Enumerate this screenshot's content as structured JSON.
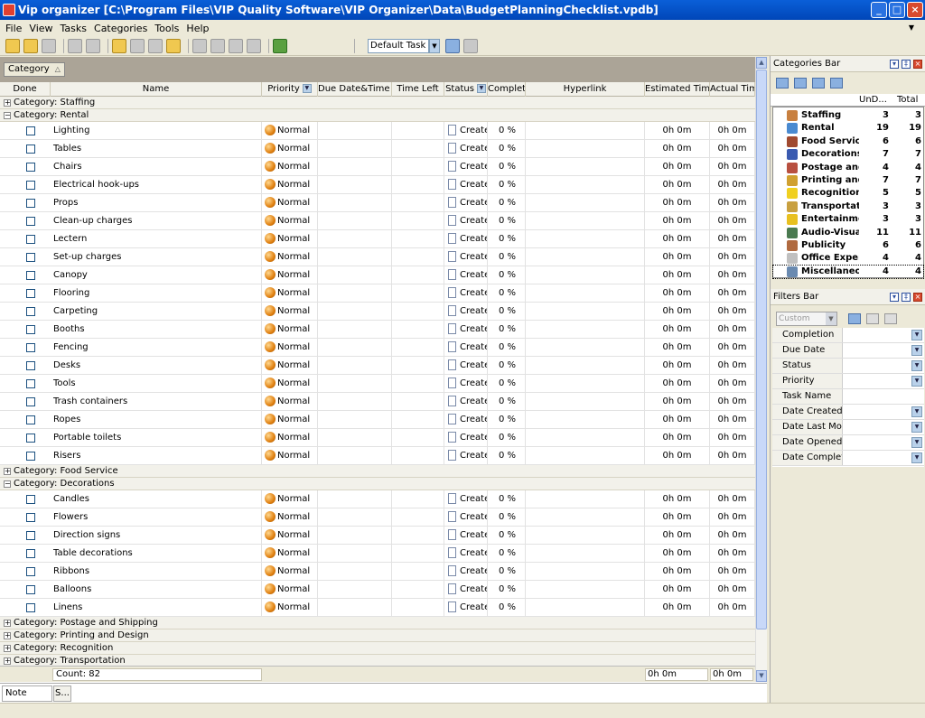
{
  "window": {
    "title": "Vip organizer [C:\\Program Files\\VIP Quality Software\\VIP Organizer\\Data\\BudgetPlanningChecklist.vpdb]"
  },
  "menu": [
    "File",
    "View",
    "Tasks",
    "Categories",
    "Tools",
    "Help"
  ],
  "toolbar": {
    "view_value": "Default Task V"
  },
  "group_chip": "Category",
  "columns": [
    "Done",
    "Name",
    "Priority",
    "Due Date&Time",
    "Time Left",
    "Status",
    "Complete",
    "Hyperlink",
    "Estimated Time",
    "Actual Time"
  ],
  "row_defaults": {
    "priority": "Normal",
    "status": "Create",
    "complete": "0 %",
    "estimated": "0h 0m",
    "actual": "0h 0m"
  },
  "groups": [
    {
      "label": "Category: Staffing",
      "expanded": false,
      "tasks": []
    },
    {
      "label": "Category: Rental",
      "expanded": true,
      "tasks": [
        "Lighting",
        "Tables",
        "Chairs",
        "Electrical hook-ups",
        "Props",
        "Clean-up charges",
        "Lectern",
        "Set-up charges",
        "Canopy",
        "Flooring",
        "Carpeting",
        "Booths",
        "Fencing",
        "Desks",
        "Tools",
        "Trash containers",
        "Ropes",
        "Portable toilets",
        "Risers"
      ]
    },
    {
      "label": "Category: Food Service",
      "expanded": false,
      "tasks": []
    },
    {
      "label": "Category: Decorations",
      "expanded": true,
      "tasks": [
        "Candles",
        "Flowers",
        "Direction signs",
        "Table decorations",
        "Ribbons",
        "Balloons",
        "Linens"
      ]
    },
    {
      "label": "Category: Postage and Shipping",
      "expanded": false,
      "tasks": []
    },
    {
      "label": "Category: Printing and Design",
      "expanded": false,
      "tasks": []
    },
    {
      "label": "Category: Recognition",
      "expanded": false,
      "tasks": []
    },
    {
      "label": "Category: Transportation",
      "expanded": false,
      "tasks": []
    }
  ],
  "footer": {
    "count": "Count: 82",
    "estimated_total": "0h 0m",
    "actual_total": "0h 0m"
  },
  "note_tab": {
    "label": "Note",
    "button": "S..."
  },
  "categories_bar": {
    "title": "Categories Bar",
    "col_undone": "UnD...",
    "col_total": "Total",
    "items": [
      {
        "name": "Staffing",
        "undone": "3",
        "total": "3",
        "color": "#c88040"
      },
      {
        "name": "Rental",
        "undone": "19",
        "total": "19",
        "color": "#4a8ad0"
      },
      {
        "name": "Food Service",
        "undone": "6",
        "total": "6",
        "color": "#a04a30"
      },
      {
        "name": "Decorations",
        "undone": "7",
        "total": "7",
        "color": "#3a5ab0"
      },
      {
        "name": "Postage and",
        "undone": "4",
        "total": "4",
        "color": "#b85040"
      },
      {
        "name": "Printing and I",
        "undone": "7",
        "total": "7",
        "color": "#d0a030"
      },
      {
        "name": "Recognition",
        "undone": "5",
        "total": "5",
        "color": "#f0d020"
      },
      {
        "name": "Transportatio",
        "undone": "3",
        "total": "3",
        "color": "#c8a040"
      },
      {
        "name": "Entertainmen",
        "undone": "3",
        "total": "3",
        "color": "#e8c020"
      },
      {
        "name": "Audio-Visual",
        "undone": "11",
        "total": "11",
        "color": "#4a7a50"
      },
      {
        "name": "Publicity",
        "undone": "6",
        "total": "6",
        "color": "#b06a40"
      },
      {
        "name": "Office Expen",
        "undone": "4",
        "total": "4",
        "color": "#c0c0c0"
      },
      {
        "name": "Miscellaneou",
        "undone": "4",
        "total": "4",
        "color": "#6a8ab0"
      }
    ]
  },
  "filters_bar": {
    "title": "Filters Bar",
    "preset": "Custom",
    "items": [
      {
        "label": "Completion",
        "dropdown": true
      },
      {
        "label": "Due Date",
        "dropdown": true
      },
      {
        "label": "Status",
        "dropdown": true
      },
      {
        "label": "Priority",
        "dropdown": true
      },
      {
        "label": "Task Name",
        "dropdown": false
      },
      {
        "label": "Date Created",
        "dropdown": true
      },
      {
        "label": "Date Last Modifi",
        "dropdown": true
      },
      {
        "label": "Date Opened",
        "dropdown": true
      },
      {
        "label": "Date Completed",
        "dropdown": true
      }
    ]
  }
}
